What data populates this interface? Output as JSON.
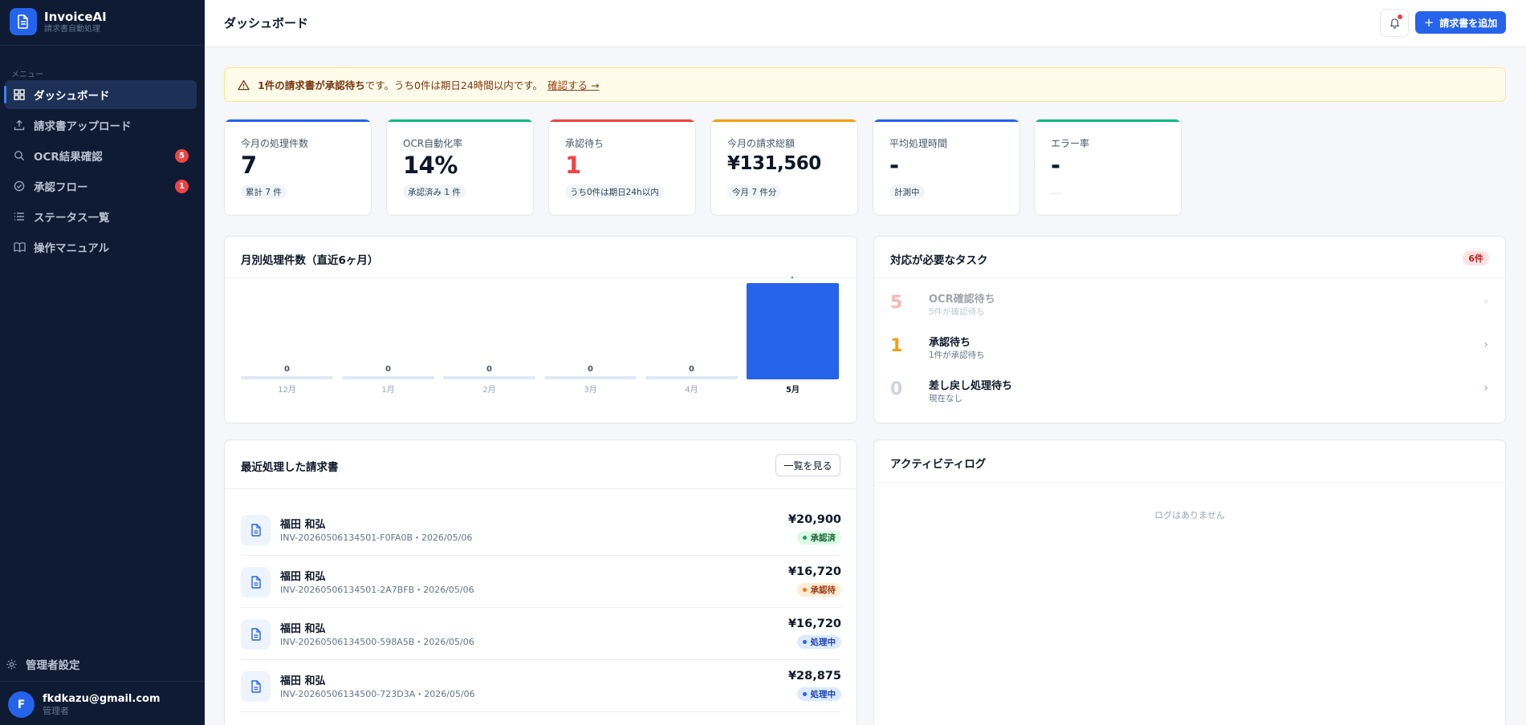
{
  "brand": {
    "name": "InvoiceAI",
    "subtitle": "請求書自動処理"
  },
  "sidebar": {
    "menu_label": "メニュー",
    "items": [
      {
        "label": "ダッシュボード",
        "icon": "grid-icon",
        "active": true,
        "badge": ""
      },
      {
        "label": "請求書アップロード",
        "icon": "upload-icon",
        "active": false,
        "badge": ""
      },
      {
        "label": "OCR結果確認",
        "icon": "search-icon",
        "active": false,
        "badge": "5"
      },
      {
        "label": "承認フロー",
        "icon": "check-circle-icon",
        "active": false,
        "badge": "1"
      },
      {
        "label": "ステータス一覧",
        "icon": "list-icon",
        "active": false,
        "badge": ""
      },
      {
        "label": "操作マニュアル",
        "icon": "book-icon",
        "active": false,
        "badge": ""
      }
    ],
    "settings_label": "管理者設定",
    "user": {
      "initial": "F",
      "email": "fkdkazu@gmail.com",
      "role": "管理者"
    }
  },
  "header": {
    "title": "ダッシュボード",
    "add_button": "請求書を追加"
  },
  "alert": {
    "strong": "1件の請求書が承認待ち",
    "text": "です。うち0件は期日24時間以内です。",
    "link": "確認する →"
  },
  "stats": [
    {
      "label": "今月の処理件数",
      "value": "7",
      "tag": "累計 7 件",
      "color": "#2563eb",
      "value_color": "#0f172a"
    },
    {
      "label": "OCR自動化率",
      "value": "14%",
      "tag": "承認済み 1 件",
      "color": "#10b981",
      "value_color": "#0f172a"
    },
    {
      "label": "承認待ち",
      "value": "1",
      "tag": "うち0件は期日24h以内",
      "color": "#ef4444",
      "value_color": "#ef4444"
    },
    {
      "label": "今月の請求総額",
      "value": "¥131,560",
      "tag": "今月 7 件分",
      "color": "#f59e0b",
      "value_color": "#0f172a"
    },
    {
      "label": "平均処理時間",
      "value": "-",
      "tag": "計測中",
      "color": "#2563eb",
      "value_color": "#0f172a"
    },
    {
      "label": "エラー率",
      "value": "-",
      "tag": "",
      "color": "#10b981",
      "value_color": "#0f172a"
    }
  ],
  "chart_panel": {
    "title": "月別処理件数（直近6ヶ月）"
  },
  "chart_data": {
    "type": "bar",
    "categories": [
      "12月",
      "1月",
      "2月",
      "3月",
      "4月",
      "5月"
    ],
    "values": [
      0,
      0,
      0,
      0,
      0,
      7
    ],
    "highlight_index": 5,
    "colors": {
      "bar": "#2563eb",
      "empty": "#e0e9f5",
      "label": "#475569",
      "highlight_label": "#2563eb"
    }
  },
  "tasks": {
    "title": "対応が必要なタスク",
    "count": "6件",
    "items": [
      {
        "num": "5",
        "title": "OCR確認待ち",
        "sub": "5件が確認待ち",
        "color": "#ef4444",
        "faded": true
      },
      {
        "num": "1",
        "title": "承認待ち",
        "sub": "1件が承認待ち",
        "color": "#f59e0b",
        "faded": false
      },
      {
        "num": "0",
        "title": "差し戻し処理待ち",
        "sub": "現在なし",
        "color": "#cbd5e1",
        "faded": false
      }
    ]
  },
  "recent": {
    "title": "最近処理した請求書",
    "view_all": "一覧を見る",
    "rows": [
      {
        "name": "福田 和弘",
        "meta": "INV-20260506134501-F0FA0B・2026/05/06",
        "amount": "¥20,900",
        "status": "承認済",
        "status_type": "approved"
      },
      {
        "name": "福田 和弘",
        "meta": "INV-20260506134501-2A7BFB・2026/05/06",
        "amount": "¥16,720",
        "status": "承認待",
        "status_type": "pending"
      },
      {
        "name": "福田 和弘",
        "meta": "INV-20260506134500-598A5B・2026/05/06",
        "amount": "¥16,720",
        "status": "処理中",
        "status_type": "processing"
      },
      {
        "name": "福田 和弘",
        "meta": "INV-20260506134500-723D3A・2026/05/06",
        "amount": "¥28,875",
        "status": "処理中",
        "status_type": "processing"
      }
    ]
  },
  "activity": {
    "title": "アクティビティログ",
    "empty": "ログはありません"
  }
}
